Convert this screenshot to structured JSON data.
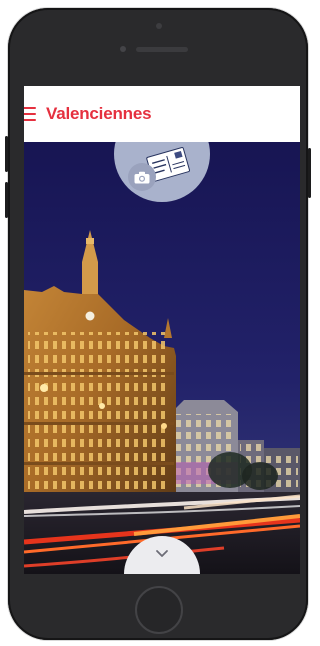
{
  "header": {
    "title": "Valenciennes",
    "menu_icon": "hamburger-menu-icon"
  },
  "hero": {
    "scene": "city-hall-at-night",
    "postcard_icon": "postcard-icon",
    "camera_icon": "camera-icon"
  },
  "footer": {
    "expand_icon": "chevron-down-icon"
  },
  "colors": {
    "accent": "#e5303f",
    "header_bg": "#ffffff",
    "sky": "#1b1a4e",
    "tab_bg": "#a9b2cc",
    "phone_body": "#2a2a2c"
  }
}
